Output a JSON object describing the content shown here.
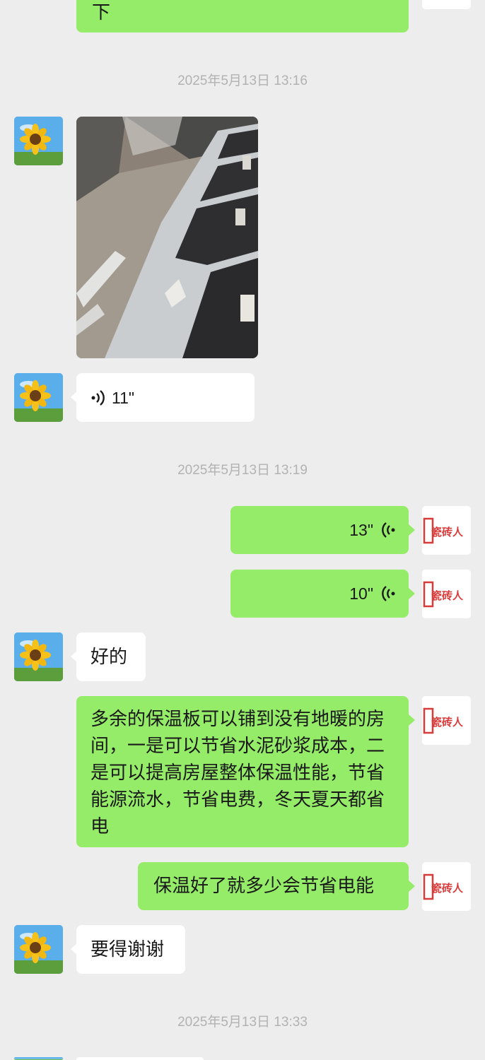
{
  "chat": {
    "top_partial_message": "下",
    "timestamps": [
      "2025年5月13日 13:16",
      "2025年5月13日 13:19",
      "2025年5月13日 13:33"
    ],
    "voice_left": "11\"",
    "voice_right_1": "13\"",
    "voice_right_2": "10\"",
    "msg_ok": "好的",
    "msg_long": "多余的保温板可以铺到没有地暖的房间，一是可以节省水泥砂浆成本，二是可以提高房屋整体保温性能，节省能源流水，节省电费，冬天夏天都省电",
    "msg_save": "保温好了就多少会节省电能",
    "msg_thanks": "要得谢谢"
  },
  "brand_avatar": {
    "text": "瓷砖人",
    "color": "#d93a3a"
  },
  "colors": {
    "background": "#ededed",
    "green_bubble": "#95ec69",
    "white_bubble": "#ffffff",
    "timestamp": "#b2b2b2"
  },
  "icons": {
    "voice": "voice-wave-icon",
    "left_avatar": "sunflower-avatar",
    "right_avatar": "brand-logo-avatar"
  }
}
